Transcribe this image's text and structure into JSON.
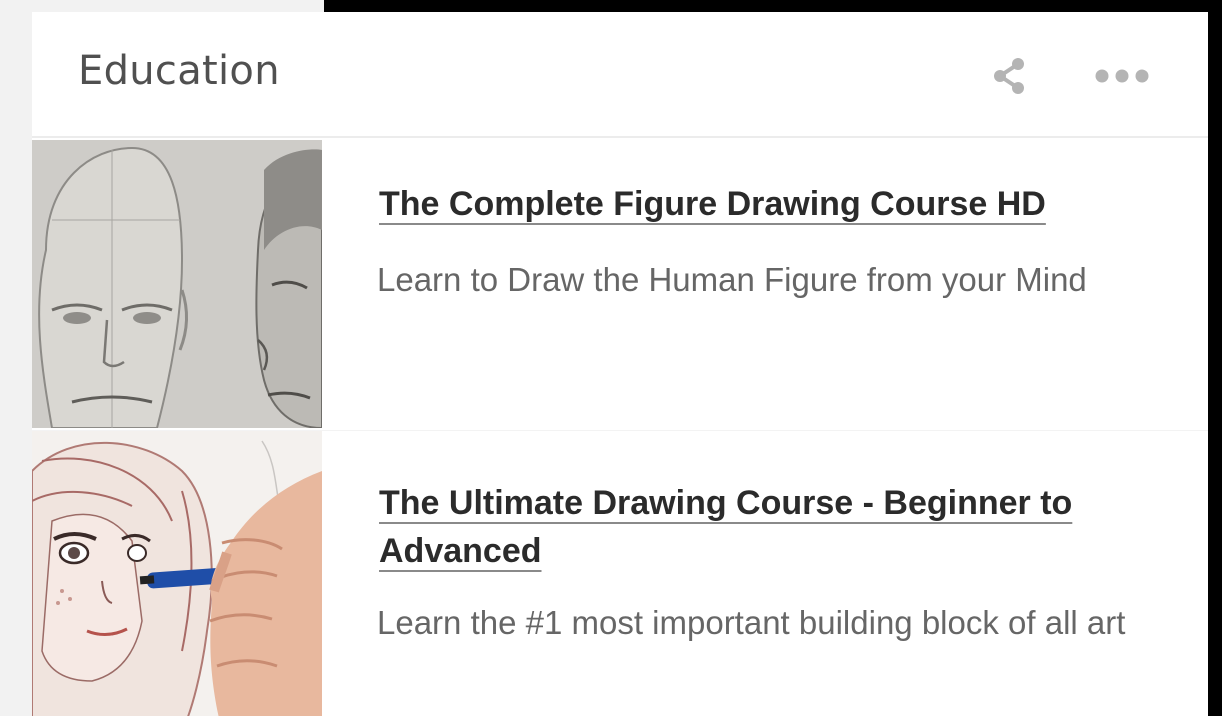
{
  "widget": {
    "title": "Education",
    "share_icon": "share-icon",
    "more_icon": "more-horizontal-icon"
  },
  "courses": [
    {
      "title": "The Complete Figure Drawing Course HD",
      "description": "Learn to Draw the Human Figure from your Mind",
      "thumbnail": "pencil sketch of heads"
    },
    {
      "title": "The Ultimate Drawing Course - Beginner to Advanced",
      "description": "Learn the #1 most important building block of all art",
      "thumbnail": "hand drawing girl portrait"
    }
  ],
  "colors": {
    "title_text": "#505050",
    "link_text": "#2b2b2b",
    "desc_text": "#666666",
    "icon": "#b4b4b4"
  }
}
